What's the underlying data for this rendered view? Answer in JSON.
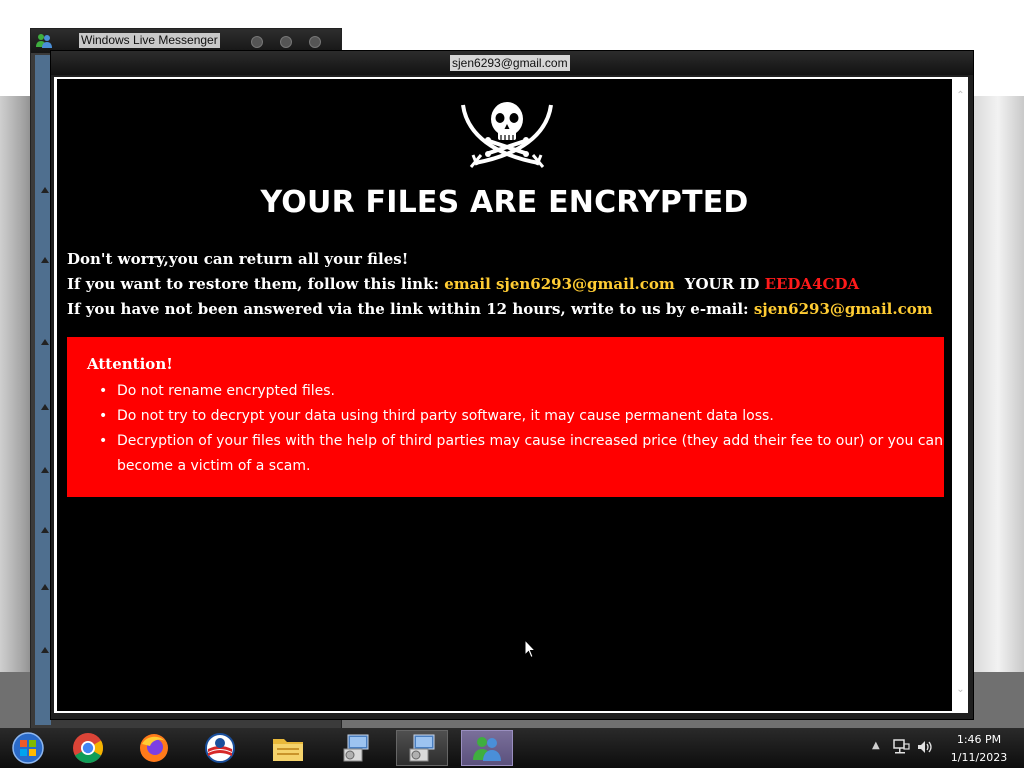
{
  "messenger_window": {
    "title": "Windows Live Messenger"
  },
  "ransom_window": {
    "title": "sjen6293@gmail.com"
  },
  "note": {
    "headline": "YOUR FILES ARE ENCRYPTED",
    "line1": "Don't worry,you can return all your files!",
    "line2_prefix": "If you want to restore them, follow this link: ",
    "line2_email": "email sjen6293@gmail.com",
    "line2_id_label": "YOUR ID ",
    "line2_id": "EEDA4CDA",
    "line3_prefix": "If you have not been answered via the link within 12 hours, write to us by e-mail: ",
    "line3_email": "sjen6293@gmail.com",
    "attention": {
      "title": "Attention!",
      "items": [
        "Do not rename encrypted files.",
        "Do not try to decrypt your data using third party software, it may cause permanent data loss.",
        "Decryption of your files with the help of third parties may cause increased price (they add their fee to our) or you can become a victim of a scam."
      ]
    },
    "colors": {
      "background": "#000000",
      "attention_box": "#ff0000",
      "highlight": "#ffcc33",
      "id": "#ff1a1a"
    }
  },
  "taskbar": {
    "items": [
      {
        "icon": "start-orb-icon"
      },
      {
        "icon": "chrome-icon"
      },
      {
        "icon": "firefox-icon"
      },
      {
        "icon": "obama-logo-icon"
      },
      {
        "icon": "file-explorer-icon"
      },
      {
        "icon": "installer-icon"
      },
      {
        "icon": "installer-icon"
      },
      {
        "icon": "messenger-icon"
      }
    ],
    "tray": {
      "icons": [
        "show-hidden-icon",
        "network-icon",
        "volume-icon"
      ]
    },
    "clock": {
      "time": "1:46 PM",
      "date": "1/11/2023"
    }
  }
}
